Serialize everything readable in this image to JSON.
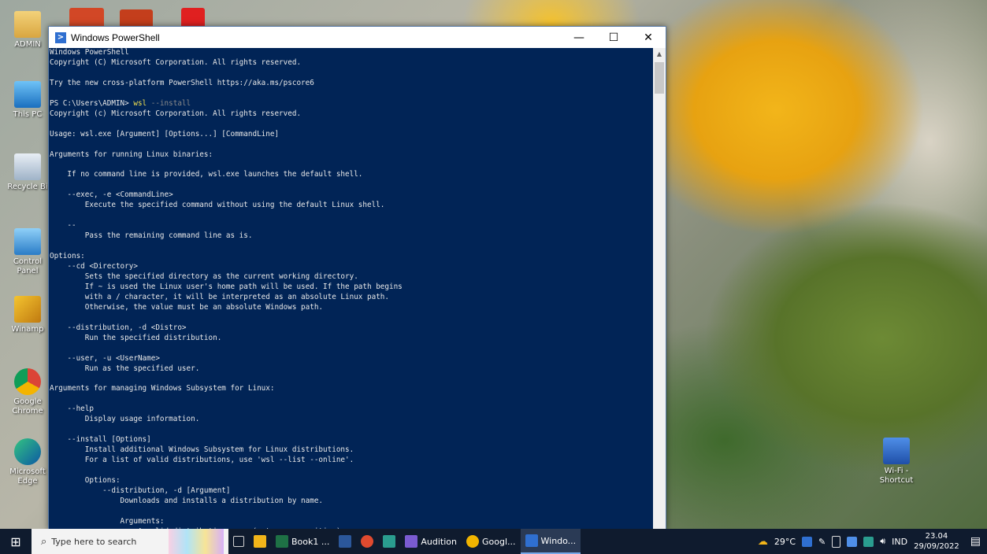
{
  "desktop": {
    "icons": [
      {
        "label": "ADMIN"
      },
      {
        "label": "This PC"
      },
      {
        "label": "Recycle Bi"
      },
      {
        "label": "Control Panel"
      },
      {
        "label": "Winamp"
      },
      {
        "label": "Google Chrome"
      },
      {
        "label": "Microsoft Edge"
      },
      {
        "label": "Wi-Fi - Shortcut"
      }
    ]
  },
  "window": {
    "title": "Windows PowerShell",
    "controls": {
      "minimize": "—",
      "maximize": "☐",
      "close": "✕"
    },
    "console": {
      "before_cmd": "Windows PowerShell\nCopyright (C) Microsoft Corporation. All rights reserved.\n\nTry the new cross-platform PowerShell https://aka.ms/pscore6\n\n",
      "prompt": "PS C:\\Users\\ADMIN> ",
      "command": "wsl",
      "command_args": " --install",
      "after_cmd": "\nCopyright (c) Microsoft Corporation. All rights reserved.\n\nUsage: wsl.exe [Argument] [Options...] [CommandLine]\n\nArguments for running Linux binaries:\n\n    If no command line is provided, wsl.exe launches the default shell.\n\n    --exec, -e <CommandLine>\n        Execute the specified command without using the default Linux shell.\n\n    --\n        Pass the remaining command line as is.\n\nOptions:\n    --cd <Directory>\n        Sets the specified directory as the current working directory.\n        If ~ is used the Linux user's home path will be used. If the path begins\n        with a / character, it will be interpreted as an absolute Linux path.\n        Otherwise, the value must be an absolute Windows path.\n\n    --distribution, -d <Distro>\n        Run the specified distribution.\n\n    --user, -u <UserName>\n        Run as the specified user.\n\nArguments for managing Windows Subsystem for Linux:\n\n    --help\n        Display usage information.\n\n    --install [Options]\n        Install additional Windows Subsystem for Linux distributions.\n        For a list of valid distributions, use 'wsl --list --online'.\n\n        Options:\n            --distribution, -d [Argument]\n                Downloads and installs a distribution by name.\n\n                Arguments:\n                    A valid distribution name (not case sensitive)."
    }
  },
  "taskbar": {
    "search_placeholder": "Type here to search",
    "items": [
      {
        "label": "",
        "color": "#d0d0d0"
      },
      {
        "label": "",
        "color": "#f2b51a"
      },
      {
        "label": "Book1 ...",
        "color": "#1e7145"
      },
      {
        "label": "",
        "color": "#2b579a"
      },
      {
        "label": "",
        "color": "#e04a2f"
      },
      {
        "label": "",
        "color": "#2a9d8f"
      },
      {
        "label": "Audition",
        "color": "#7a5bd1"
      },
      {
        "label": "Googl...",
        "color": "#f0b400"
      },
      {
        "label": "Windo...",
        "color": "#2f6fd0"
      }
    ],
    "weather": "29°C",
    "language": "IND",
    "time": "23.04",
    "date": "29/09/2022"
  }
}
